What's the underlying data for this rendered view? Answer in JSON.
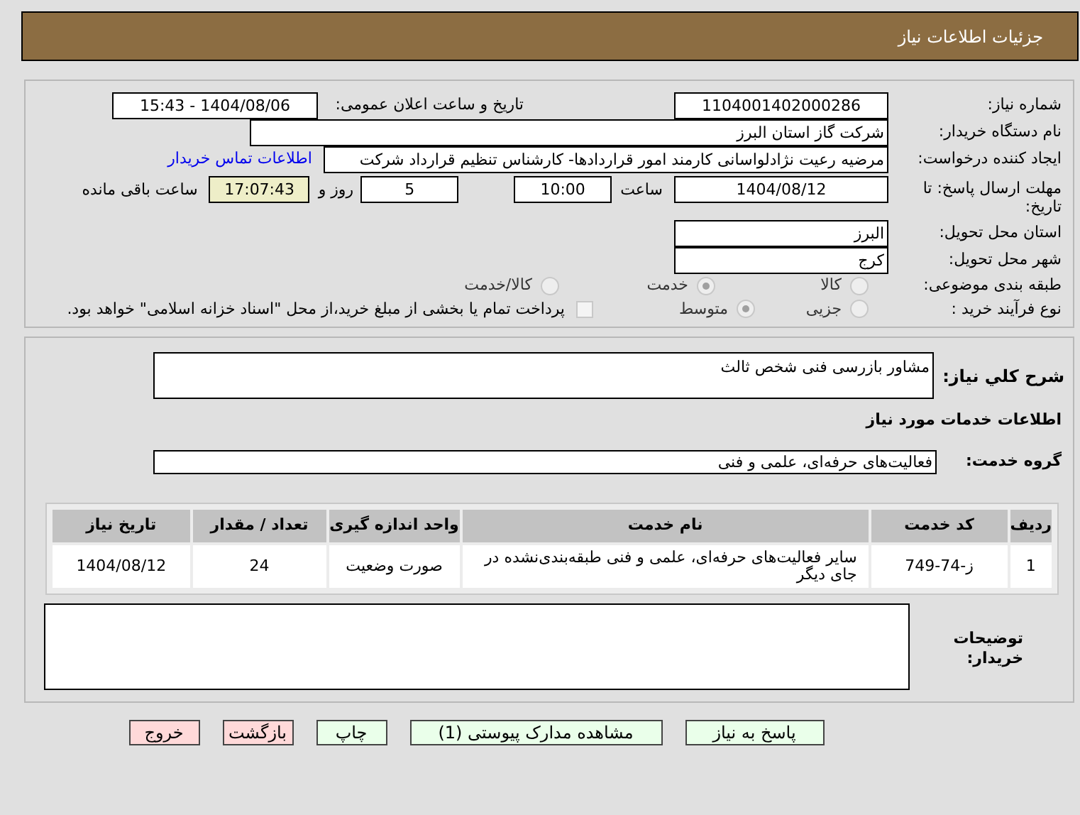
{
  "header": {
    "title": "جزئیات اطلاعات نیاز"
  },
  "details": {
    "need_number": {
      "label": "شماره نیاز:",
      "value": "1104001402000286"
    },
    "announce_datetime": {
      "label": "تاریخ و ساعت اعلان عمومی:",
      "value": "1404/08/06 - 15:43"
    },
    "buyer_org": {
      "label": "نام دستگاه خریدار:",
      "value": "شرکت گاز استان البرز"
    },
    "requester": {
      "label": "ایجاد کننده درخواست:",
      "value": "مرضیه رعیت نژادلواسانی کارمند امور قراردادها- کارشناس تنظیم قرارداد شرکت",
      "link": "اطلاعات تماس خریدار"
    },
    "deadline": {
      "label": "مهلت ارسال پاسخ: تا تاریخ:",
      "date": "1404/08/12",
      "time_label": "ساعت",
      "time": "10:00",
      "days": "5",
      "days_label": "روز و",
      "remaining": "17:07:43",
      "remaining_label": "ساعت باقی مانده"
    },
    "province": {
      "label": "استان محل تحویل:",
      "value": "البرز"
    },
    "city": {
      "label": "شهر محل تحویل:",
      "value": "کرج"
    },
    "category": {
      "label": "طبقه بندی موضوعی:",
      "options": [
        {
          "label": "کالا",
          "selected": false
        },
        {
          "label": "خدمت",
          "selected": true
        },
        {
          "label": "کالا/خدمت",
          "selected": false
        }
      ]
    },
    "process": {
      "label": "نوع فرآیند خرید :",
      "options": [
        {
          "label": "جزیی",
          "selected": false
        },
        {
          "label": "متوسط",
          "selected": true
        }
      ],
      "treasury": {
        "label": "پرداخت تمام یا بخشی از مبلغ خرید،از محل \"اسناد خزانه اسلامی\" خواهد بود.",
        "checked": false
      }
    }
  },
  "services": {
    "summary": {
      "label": "شرح کلي نیاز:",
      "value": "مشاور بازرسی فنی شخص ثالث"
    },
    "section_title": "اطلاعات خدمات مورد نیاز",
    "group": {
      "label": "گروه خدمت:",
      "value": "فعالیت‌های حرفه‌ای، علمی و فنی"
    },
    "table": {
      "columns": [
        "ردیف",
        "کد خدمت",
        "نام خدمت",
        "واحد اندازه گیری",
        "تعداد / مقدار",
        "تاریخ نیاز"
      ],
      "rows": [
        [
          "1",
          "ز-74-749",
          "سایر فعالیت‌های حرفه‌ای، علمی و فنی طبقه‌بندی‌نشده در جای دیگر",
          "صورت وضعیت",
          "24",
          "1404/08/12"
        ]
      ]
    },
    "buyer_notes": {
      "label": "توضیحات خریدار:"
    }
  },
  "buttons": [
    {
      "label": "پاسخ به نیاز",
      "kind": "primary"
    },
    {
      "label": "مشاهده مدارک پیوستی (1)",
      "kind": "primary"
    },
    {
      "label": "چاپ",
      "kind": "primary"
    },
    {
      "label": "بازگشت",
      "kind": "danger"
    },
    {
      "label": "خروج",
      "kind": "danger"
    }
  ]
}
